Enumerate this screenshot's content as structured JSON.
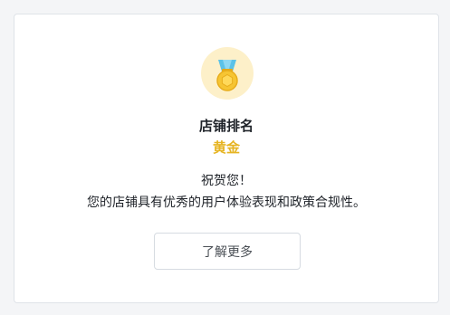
{
  "card": {
    "badge_icon": "gold-medal-icon",
    "title": "店铺排名",
    "rank": "黄金",
    "congrats": "祝贺您！",
    "description": "您的店铺具有优秀的用户体验表现和政策合规性。",
    "button_label": "了解更多"
  },
  "colors": {
    "rank_gold": "#e6b422",
    "medal_bg": "#fdf0c9",
    "ribbon_blue": "#5bc2e8",
    "medal_gold": "#f6c533"
  }
}
